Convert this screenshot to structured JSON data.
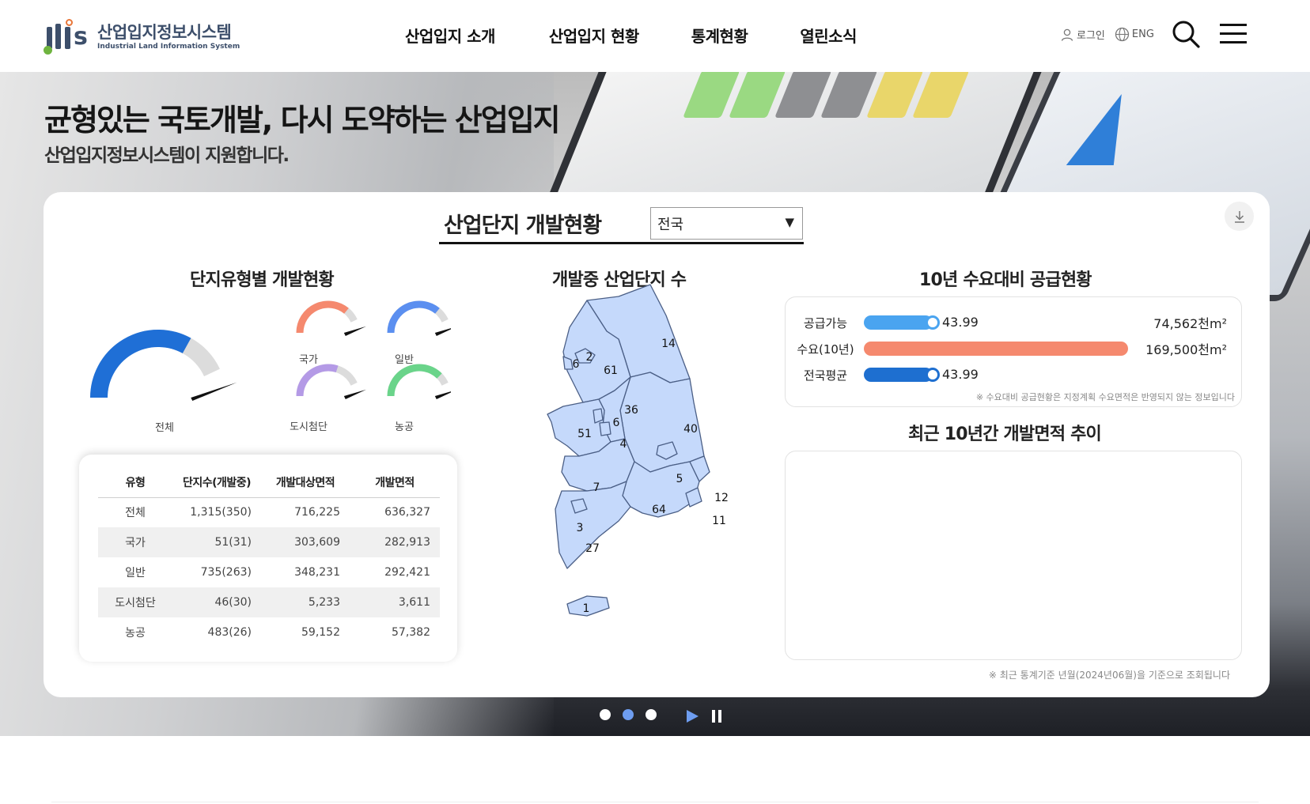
{
  "header": {
    "logo_title": "산업입지정보시스템",
    "logo_subtitle": "Industrial Land Information System",
    "nav": [
      "산업입지 소개",
      "산업입지 현황",
      "통계현황",
      "열린소식"
    ],
    "login_label": "로그인",
    "lang_label": "ENG"
  },
  "hero": {
    "title": "균형있는 국토개발, 다시 도약하는 산업입지",
    "subtitle": "산업입지정보시스템이 지원합니다."
  },
  "dashboard": {
    "title": "산업단지 개발현황",
    "region_selected": "전국",
    "type_section_title": "단지유형별 개발현황",
    "map_section_title": "개발중 산업단지 수",
    "supply_section_title": "10년 수요대비 공급현황",
    "trend_section_title": "최근 10년간 개발면적 추이",
    "bottom_note": "※ 최근 통계기준 년월(2024년06월)을 기준으로 조회됩니다"
  },
  "gauges": [
    {
      "label": "전체",
      "value": 0.66,
      "color": "#1f6fd6"
    },
    {
      "label": "국가",
      "value": 0.72,
      "color": "#f5896e"
    },
    {
      "label": "일반",
      "value": 0.72,
      "color": "#5b8ff0"
    },
    {
      "label": "도시첨단",
      "value": 0.6,
      "color": "#b49ae6"
    },
    {
      "label": "농공",
      "value": 0.75,
      "color": "#6ad48a"
    }
  ],
  "table": {
    "headers": [
      "유형",
      "단지수(개발중)",
      "개발대상면적",
      "개발면적"
    ],
    "rows": [
      [
        "전체",
        "1,315(350)",
        "716,225",
        "636,327"
      ],
      [
        "국가",
        "51(31)",
        "303,609",
        "282,913"
      ],
      [
        "일반",
        "735(263)",
        "348,231",
        "292,421"
      ],
      [
        "도시첨단",
        "46(30)",
        "5,233",
        "3,611"
      ],
      [
        "농공",
        "483(26)",
        "59,152",
        "57,382"
      ]
    ]
  },
  "map_counts": {
    "gyeonggi_inner": "2",
    "incheon": "6",
    "gyeonggi": "61",
    "gangwon": "14",
    "sejong": "6",
    "chungbuk": "36",
    "chungnam": "51",
    "daejeon": "4",
    "gyeongbuk": "40",
    "jeonbuk": "7",
    "daegu": "5",
    "gyeongnam": "64",
    "ulsan": "12",
    "busan": "11",
    "gwangju": "3",
    "jeonnam": "27",
    "jeju": "1"
  },
  "supply": {
    "rows": [
      {
        "label": "공급가능",
        "value": "43.99",
        "fraction": 0.26,
        "color": "#4aa4f0"
      },
      {
        "label": "수요(10년)",
        "value": "",
        "fraction": 1.0,
        "color": "#f5896e"
      },
      {
        "label": "전국평균",
        "value": "43.99",
        "fraction": 0.26,
        "color": "#1e6fd0"
      }
    ],
    "supply_area": "74,562천m²",
    "demand_area": "169,500천m²",
    "note": "※ 수요대비 공급현황은 지정계획 수요면적은 반영되지 않는 정보입니다"
  },
  "carousel": {
    "slide_count": 3,
    "active_slide": 2
  }
}
